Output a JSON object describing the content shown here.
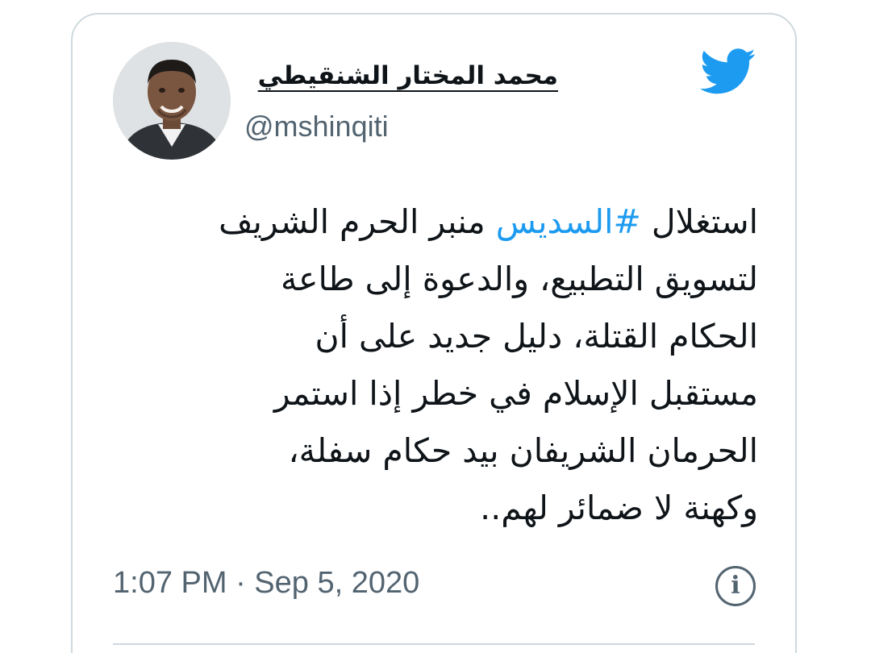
{
  "user": {
    "display_name": "محمد المختار الشنقيطي",
    "handle": "@mshinqiti"
  },
  "icons": {
    "brand": "twitter-bird-icon",
    "info": "info-icon",
    "info_glyph": "i"
  },
  "colors": {
    "brand": "#1d9bf0",
    "text": "#0f1419",
    "secondary": "#536471",
    "border": "#cfd9de"
  },
  "tweet": {
    "line1": {
      "before": "استغلال ",
      "hashtag": "#السديس",
      "after": " منبر الحرم الشريف"
    },
    "line2": "لتسويق التطبيع، والدعوة إلى طاعة",
    "line3": "الحكام القتلة، دليل جديد على أن",
    "line4": "مستقبل الإسلام في خطر إذا استمر",
    "line5": "الحرمان الشريفان بيد حكام سفلة،",
    "line6": "وكهنة لا ضمائر لهم.."
  },
  "timestamp": "1:07 PM · Sep 5, 2020"
}
